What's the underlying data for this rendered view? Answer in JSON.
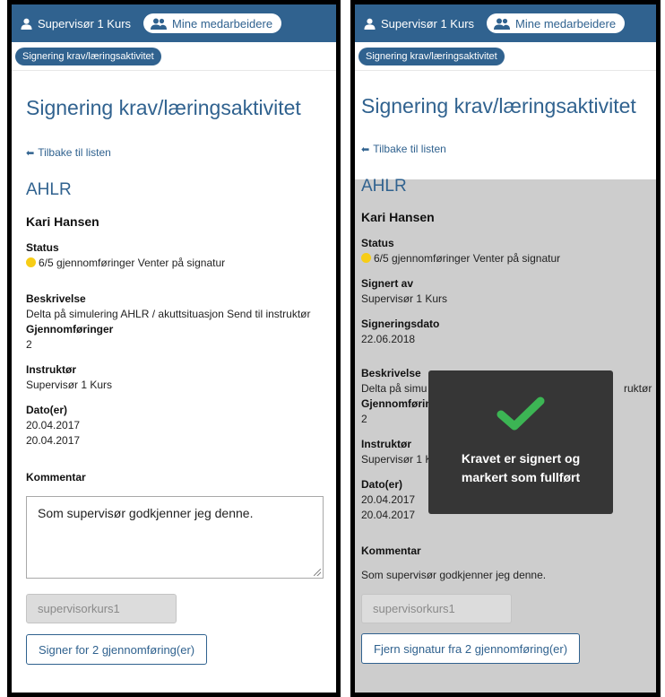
{
  "header": {
    "user_label": "Supervisør 1 Kurs",
    "team_label": "Mine medarbeidere"
  },
  "breadcrumb": "Signering krav/læringsaktivitet",
  "page_title": "Signering krav/læringsaktivitet",
  "back_link": "Tilbake til listen",
  "section_title": "AHLR",
  "person_name": "Kari Hansen",
  "labels": {
    "status": "Status",
    "signed_by": "Signert av",
    "signing_date": "Signeringsdato",
    "description": "Beskrivelse",
    "completions": "Gjennomføringer",
    "instructor": "Instruktør",
    "dates": "Dato(er)",
    "comment": "Kommentar"
  },
  "values": {
    "status": "6/5 gjennomføringer Venter på signatur",
    "signed_by": "Supervisør 1 Kurs",
    "signing_date": "22.06.2018",
    "description": "Delta på simulering AHLR / akuttsituasjon Send til instruktør",
    "completions": "2",
    "instructor": "Supervisør 1 Kurs",
    "date_1": "20.04.2017",
    "date_2": "20.04.2017",
    "comment": "Som supervisør godkjenner jeg denne."
  },
  "left_screen": {
    "username_value": "supervisorkurs1",
    "sign_button": "Signer for 2 gjennomføring(er)"
  },
  "right_screen": {
    "username_value": "supervisorkurs1",
    "unsign_button": "Fjern signatur fra 2 gjennomføring(er)",
    "description_partial": "Delta på simu",
    "description_tail": "ruktør",
    "completions_partial": "Gjennomførin",
    "instructor_partial": "Supervisør 1 K",
    "toast_message": "Kravet er signert og markert som fullført"
  },
  "colors": {
    "primary": "#30628f",
    "status_pending": "#f7cd16",
    "success_check": "#3cb554",
    "toast_bg": "#363636",
    "overlay": "#cdcdcd"
  }
}
